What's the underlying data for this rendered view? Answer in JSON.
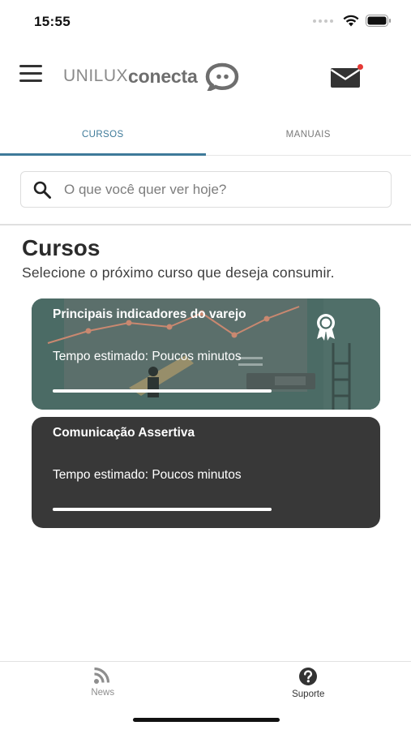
{
  "status_bar": {
    "time": "15:55"
  },
  "header": {
    "logo_light": "UNILUX",
    "logo_bold": "conecta",
    "has_unread_messages": true
  },
  "tabs": [
    {
      "label": "CURSOS",
      "active": true
    },
    {
      "label": "MANUAIS",
      "active": false
    }
  ],
  "search": {
    "placeholder": "O que você quer ver hoje?",
    "value": ""
  },
  "page": {
    "title": "Cursos",
    "subtitle": "Selecione o próximo curso que deseja consumir."
  },
  "courses": [
    {
      "title": "Principais indicadores do varejo",
      "time": "Tempo estimado: Poucos minutos",
      "progress": 1.0,
      "has_badge": true,
      "bg_color": "#4a6a64"
    },
    {
      "title": "Comunicação Assertiva",
      "time": "Tempo estimado: Poucos minutos",
      "progress": 1.0,
      "has_badge": false,
      "bg_color": "#383838"
    }
  ],
  "bottom_nav": [
    {
      "label": "News",
      "icon": "rss-icon",
      "active": false
    },
    {
      "label": "Suporte",
      "icon": "help-circle-icon",
      "active": true
    }
  ],
  "colors": {
    "accent": "#3e7a99",
    "notification": "#e53935"
  }
}
